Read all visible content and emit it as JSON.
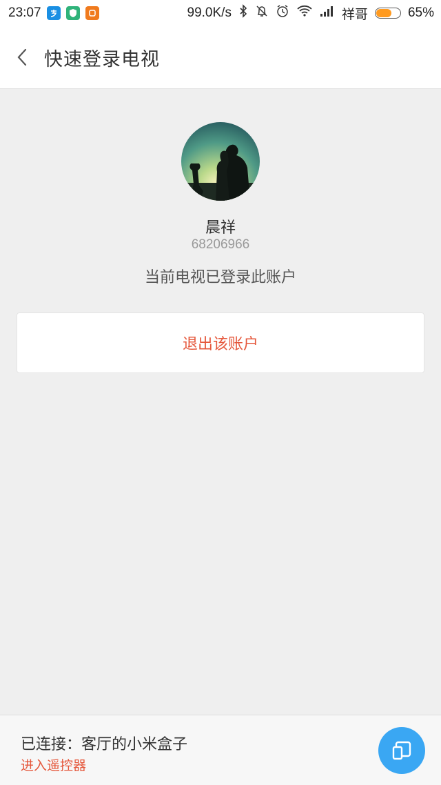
{
  "status_bar": {
    "time": "23:07",
    "net_speed": "99.0K/s",
    "carrier": "祥哥",
    "battery": "65%",
    "battery_level": 0.65,
    "app_icons": [
      "alipay-icon",
      "security-shield-icon",
      "mi-app-icon"
    ],
    "status_icons": [
      "bluetooth-icon",
      "vibrate-off-icon",
      "alarm-icon",
      "wifi-icon",
      "signal-icon"
    ]
  },
  "header": {
    "title": "快速登录电视",
    "back_icon": "chevron-left-icon"
  },
  "profile": {
    "name": "晨祥",
    "user_id": "68206966",
    "status": "当前电视已登录此账户"
  },
  "logout": {
    "label": "退出该账户"
  },
  "footer": {
    "connected_text": "已连接：客厅的小米盒子",
    "remote_link": "进入遥控器",
    "fab_icon": "remote-device-icon"
  },
  "colors": {
    "accent_red": "#e5573b",
    "fab_blue": "#3aa7f3",
    "background": "#efefef"
  }
}
